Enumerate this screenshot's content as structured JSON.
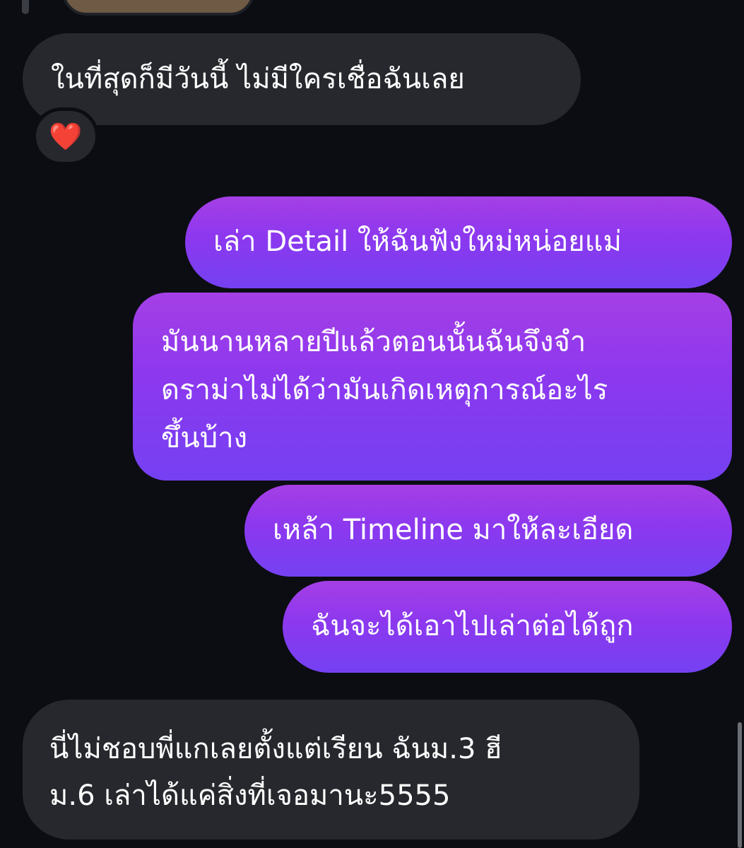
{
  "messages": [
    {
      "direction": "incoming",
      "text": "ในที่สุดก็มีวันนี้ ไม่มีใครเชื่อฉันเลย",
      "reaction": "❤️"
    },
    {
      "direction": "outgoing",
      "text": "เล่า Detail ให้ฉันฟังใหม่หน่อยแม่"
    },
    {
      "direction": "outgoing",
      "lines": [
        "มันนานหลายปีแล้วตอนนั้นฉันจึงจำ",
        "ดราม่าไม่ได้ว่ามันเกิดเหตุการณ์อะไร",
        "ขึ้นบ้าง"
      ]
    },
    {
      "direction": "outgoing",
      "text": "เหล้า Timeline มาให้ละเอียด"
    },
    {
      "direction": "outgoing",
      "text": "ฉันจะได้เอาไปเล่าต่อได้ถูก"
    },
    {
      "direction": "incoming",
      "lines": [
        "นี่ไม่ชอบพี่แกเลยตั้งแต่เรียน ฉันม.3 ฮี",
        "ม.6 เล่าได้แค่สิ่งที่เจอมานะ5555"
      ]
    }
  ],
  "colors": {
    "background": "#0b0d12",
    "incoming_bubble": "#26282d",
    "outgoing_gradient_top": "#a53fe5",
    "outgoing_gradient_bottom": "#7541f2",
    "text": "#ffffff",
    "reaction_heart": "#e8262b"
  },
  "icons": {
    "reaction": "heart-icon"
  }
}
